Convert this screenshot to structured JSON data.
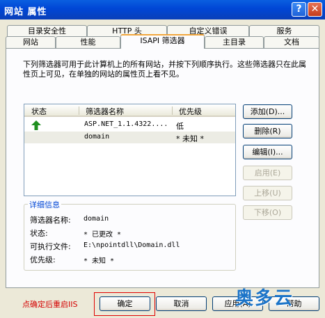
{
  "window": {
    "title": "网站 属性",
    "help_glyph": "?",
    "close_glyph": "✕"
  },
  "tabs_top": [
    "目录安全性",
    "HTTP 头",
    "自定义错误",
    "服务"
  ],
  "tabs_bottom": [
    "网站",
    "性能",
    "ISAPI 筛选器",
    "主目录",
    "文档"
  ],
  "active_tab": "ISAPI 筛选器",
  "description": "下列筛选器可用于此计算机上的所有网站，并按下列顺序执行。这些筛选器只在此属性页上可见，在单独的网站的属性页上看不见。",
  "filter_list": {
    "columns": [
      "状态",
      "筛选器名称",
      "优先级"
    ],
    "rows": [
      {
        "status_icon": "green-up-arrow-icon",
        "name": "ASP.NET_1.1.4322....",
        "priority": "低"
      },
      {
        "status_icon": "",
        "name": "domain",
        "priority": "* 未知 *"
      }
    ]
  },
  "buttons": {
    "add": "添加(D)...",
    "remove": "删除(R)",
    "edit": "编辑(I)...",
    "enable": "启用(E)",
    "move_up": "上移(U)",
    "move_down": "下移(O)"
  },
  "details": {
    "title": "详细信息",
    "labels": [
      "筛选器名称:",
      "状态:",
      "可执行文件:",
      "优先级:"
    ],
    "values": [
      "domain",
      "* 已更改 *",
      "E:\\npointdll\\Domain.dll",
      "* 未知 *"
    ]
  },
  "footer": {
    "note": "点确定后重启IIS",
    "ok": "确定",
    "cancel": "取消",
    "apply": "应用(A)",
    "help": "帮助"
  },
  "watermark": "奥多云",
  "colors": {
    "title_bar": "#0046d5",
    "note": "#d40000",
    "highlight_box": "#e00000",
    "group_title": "#0046d5",
    "arrow": "#1f8f1f"
  }
}
